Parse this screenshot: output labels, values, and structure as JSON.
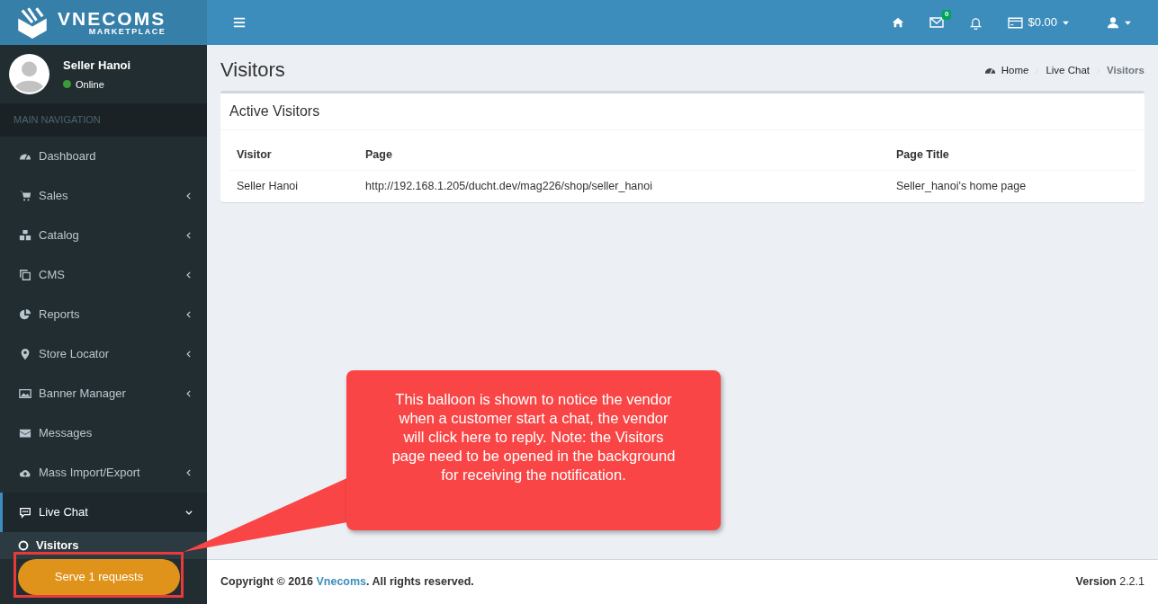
{
  "brand": {
    "name": "VNECOMS",
    "tagline": "MARKETPLACE"
  },
  "topbar": {
    "mail_count": "0",
    "balance": "$0.00"
  },
  "user": {
    "name": "Seller Hanoi",
    "status": "Online",
    "online": true
  },
  "sidebar": {
    "header": "MAIN NAVIGATION",
    "items": [
      {
        "label": "Dashboard",
        "selected": false
      },
      {
        "label": "Sales",
        "expanded": false,
        "selected": false
      },
      {
        "label": "Catalog",
        "expanded": false,
        "selected": false
      },
      {
        "label": "CMS",
        "expanded": false,
        "selected": false
      },
      {
        "label": "Reports",
        "expanded": false,
        "selected": false
      },
      {
        "label": "Store Locator",
        "expanded": false,
        "selected": false
      },
      {
        "label": "Banner Manager",
        "expanded": false,
        "selected": false
      },
      {
        "label": "Messages",
        "selected": false
      },
      {
        "label": "Mass Import/Export",
        "expanded": false,
        "selected": false
      },
      {
        "label": "Live Chat",
        "expanded": true,
        "selected": true,
        "children": [
          {
            "label": "Visitors",
            "selected": true
          }
        ]
      }
    ]
  },
  "page": {
    "title": "Visitors",
    "breadcrumb": [
      {
        "label": "Home"
      },
      {
        "label": "Live Chat"
      },
      {
        "label": "Visitors"
      }
    ]
  },
  "panel": {
    "title": "Active Visitors",
    "table": {
      "columns": [
        "Visitor",
        "Page",
        "Page Title"
      ],
      "rows": [
        [
          "Seller Hanoi",
          "http://192.168.1.205/ducht.dev/mag226/shop/seller_hanoi",
          "Seller_hanoi's home page"
        ]
      ]
    }
  },
  "footer": {
    "copyright": "Copyright © 2016 **Vnecoms**. All rights reserved.",
    "version_label": "Version",
    "version": "2.2.1"
  },
  "notification": {
    "label": "Serve 1 requests"
  },
  "callout": {
    "text": "This balloon is shown to notice the vendor when a customer start a chat, the vendor will click here to reply. Note: the Visitors page need to be opened in the background for receiving the notification."
  }
}
